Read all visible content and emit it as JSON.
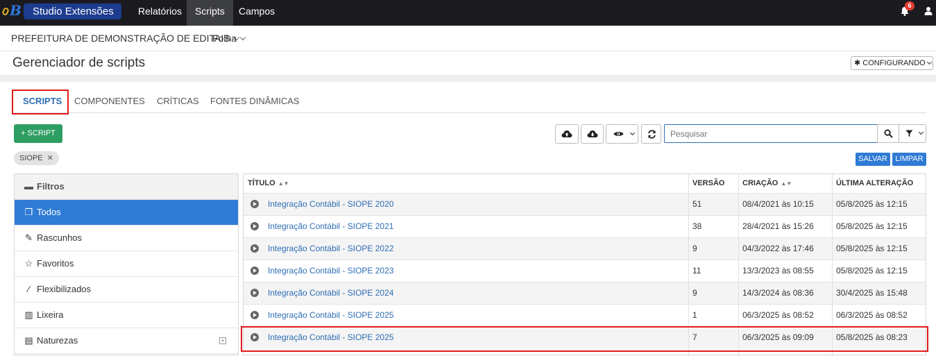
{
  "topbar": {
    "brand": "Studio Extensões",
    "nav": [
      "Relatórios",
      "Scripts",
      "Campos"
    ],
    "active_nav": "Scripts",
    "notification_count": "6"
  },
  "subbar": {
    "entity": "PREFEITURA DE DEMONSTRAÇÃO DE EDITAIS",
    "module": "Folha"
  },
  "header": {
    "title": "Gerenciador de scripts",
    "config_label": "CONFIGURANDO"
  },
  "tabs": [
    "SCRIPTS",
    "COMPONENTES",
    "CRÍTICAS",
    "FONTES DINÂMICAS"
  ],
  "toolbar": {
    "add_label": "+ SCRIPT",
    "search_placeholder": "Pesquisar",
    "save_label": "SALVAR",
    "clear_label": "LIMPAR",
    "chip": "SIOPE"
  },
  "filters": {
    "heading": "Filtros",
    "items": [
      "Todos",
      "Rascunhos",
      "Favoritos",
      "Flexibilizados",
      "Lixeira",
      "Naturezas"
    ]
  },
  "table": {
    "columns": [
      "TÍTULO",
      "VERSÃO",
      "CRIAÇÃO",
      "ÚLTIMA ALTERAÇÃO"
    ],
    "rows": [
      {
        "title": "Integração Contábil - SIOPE 2020",
        "version": "51",
        "created": "08/4/2021 às 10:15",
        "updated": "05/8/2025 às 12:15"
      },
      {
        "title": "Integração Contábil - SIOPE 2021",
        "version": "38",
        "created": "28/4/2021 às 15:26",
        "updated": "05/8/2025 às 12:15"
      },
      {
        "title": "Integração Contábil - SIOPE 2022",
        "version": "9",
        "created": "04/3/2022 às 17:46",
        "updated": "05/8/2025 às 12:15"
      },
      {
        "title": "Integração Contábil - SIOPE 2023",
        "version": "11",
        "created": "13/3/2023 às 08:55",
        "updated": "05/8/2025 às 12:15"
      },
      {
        "title": "Integração Contábil - SIOPE 2024",
        "version": "9",
        "created": "14/3/2024 às 08:36",
        "updated": "30/4/2025 às 15:48"
      },
      {
        "title": "Integração Contábil - SIOPE 2025",
        "version": "1",
        "created": "06/3/2025 às 08:52",
        "updated": "06/3/2025 às 08:52"
      },
      {
        "title": "Integração Contábil - SIOPE 2025",
        "version": "7",
        "created": "06/3/2025 às 09:09",
        "updated": "05/8/2025 às 08:23"
      }
    ]
  },
  "colors": {
    "accent": "#2f7bd5",
    "success": "#2f9e63",
    "highlight": "#e11a1a",
    "topbar": "#1b1b1f"
  }
}
